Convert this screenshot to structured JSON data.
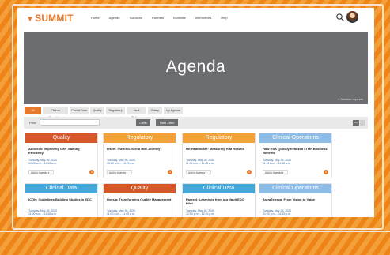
{
  "colors": {
    "accent": "#e8782a",
    "quality": "#d4582a",
    "regulatory": "#f3a23a",
    "clinical_ops": "#8dbde6",
    "clinical_data": "#46a8d8",
    "hero_bg": "#6c6d70"
  },
  "header": {
    "logo_mark": "▼",
    "logo": "SUMMIT",
    "nav": [
      "Home",
      "Agenda",
      "Solutions",
      "Partners",
      "Biorelate",
      "Interactives",
      "Help"
    ],
    "search_icon": "search-icon",
    "avatar_icon": "avatar"
  },
  "hero": {
    "title": "Agenda",
    "link": "» Session repeats"
  },
  "tabs": [
    {
      "label": "All Sessions",
      "active": true
    },
    {
      "label": "Clinical Operations",
      "active": false
    },
    {
      "label": "Clinical Data",
      "active": false
    },
    {
      "label": "Quality",
      "active": false
    },
    {
      "label": "Regulatory",
      "active": false
    },
    {
      "label": "Vault Platform",
      "active": false
    },
    {
      "label": "Safety",
      "active": false
    },
    {
      "label": "My Agenda",
      "active": false
    }
  ],
  "filter": {
    "label": "Filter",
    "placeholder": "",
    "clear": "Clear",
    "timezone": "Time Zone",
    "toggle_on": "On"
  },
  "cards": [
    {
      "category": "Quality",
      "color_key": "quality",
      "title": "Abiotech: Improving GxP Training Efficiency",
      "date": "Tuesday, May 26, 2020",
      "time": "10:00 a.m. - 10:45 a.m.",
      "add": "Add to Agenda ▾"
    },
    {
      "category": "Regulatory",
      "color_key": "regulatory",
      "title": "Ipsen: The End-to-end RIM Journey",
      "date": "Tuesday, May 26, 2020",
      "time": "10:00 a.m. - 10:45 a.m.",
      "add": "Add to Agenda ▾"
    },
    {
      "category": "Regulatory",
      "color_key": "regulatory",
      "title": "GE Healthcare: Measuring RIM Results",
      "date": "Tuesday, May 26, 2020",
      "time": "11:00 a.m. - 11:45 a.m.",
      "add": "Add to Agenda ▾"
    },
    {
      "category": "Clinical Operations",
      "color_key": "clinical_ops",
      "title": "How GSK Quickly Realized eTMF Business Benefits",
      "date": "Tuesday, May 26, 2020",
      "time": "11:00 a.m. - 11:45 a.m.",
      "add": "Add to Agenda ▾"
    },
    {
      "category": "Clinical Data",
      "color_key": "clinical_data",
      "title": "ICON: Guidelines/Building Studies in EDC",
      "date": "Tuesday, May 26, 2020",
      "time": "11:00 a.m. - 11:45 a.m.",
      "add": "Add to Agenda ▾"
    },
    {
      "category": "Quality",
      "color_key": "quality",
      "title": "Idorsia: Transforming Quality Management",
      "date": "Tuesday, May 26, 2020",
      "time": "11:00 a.m. - 11:45 a.m.",
      "add": "Add to Agenda ▾"
    },
    {
      "category": "Clinical Data",
      "color_key": "clinical_data",
      "title": "Parexel: Learnings from our Vault EDC Pilot",
      "date": "Tuesday, May 26, 2020",
      "time": "12:00 p.m. - 12:45 p.m.",
      "add": "Add to Agenda ▾"
    },
    {
      "category": "Clinical Operations",
      "color_key": "clinical_ops",
      "title": "AstraZeneca: From Vision to Value",
      "date": "Tuesday, May 26, 2020",
      "time": "01:00 p.m. - 01:45 p.m.",
      "add": "Add to Agenda ▾"
    }
  ]
}
